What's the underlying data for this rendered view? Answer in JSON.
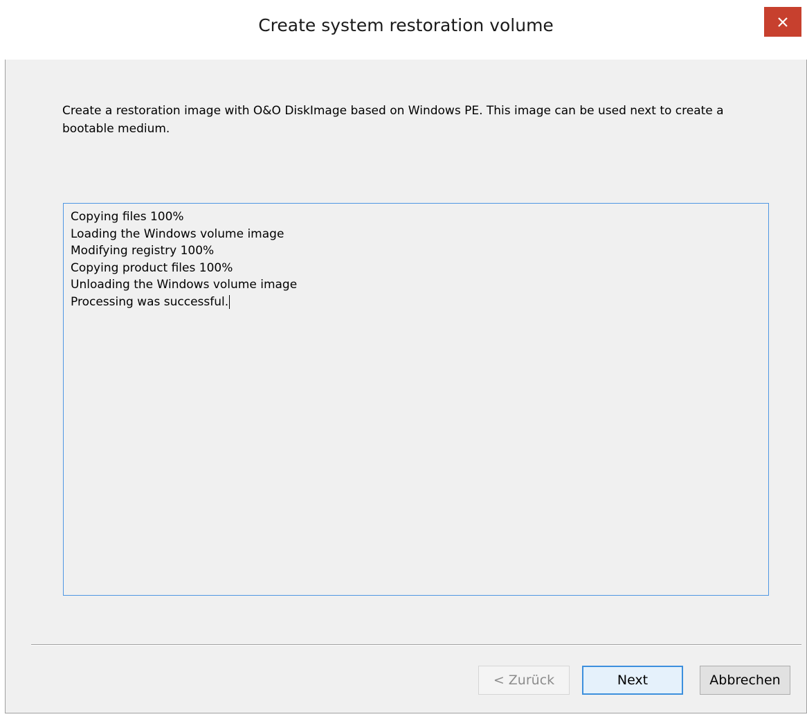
{
  "window": {
    "title": "Create system restoration volume",
    "close_label": "×"
  },
  "description": "Create a restoration image with O&O DiskImage based on Windows PE. This image can be used next to create a bootable medium.",
  "log": {
    "lines": [
      "Copying files 100%",
      "Loading the Windows volume image",
      "Modifying registry 100%",
      "Copying product files 100%",
      "Unloading the Windows volume image",
      "Processing was successful."
    ]
  },
  "buttons": {
    "back_label": "< Zurück",
    "next_label": "Next",
    "cancel_label": "Abbrechen"
  },
  "colors": {
    "close_button": "#c7402e",
    "focus_border": "#3c8fdd",
    "log_border": "#4d96e3"
  }
}
